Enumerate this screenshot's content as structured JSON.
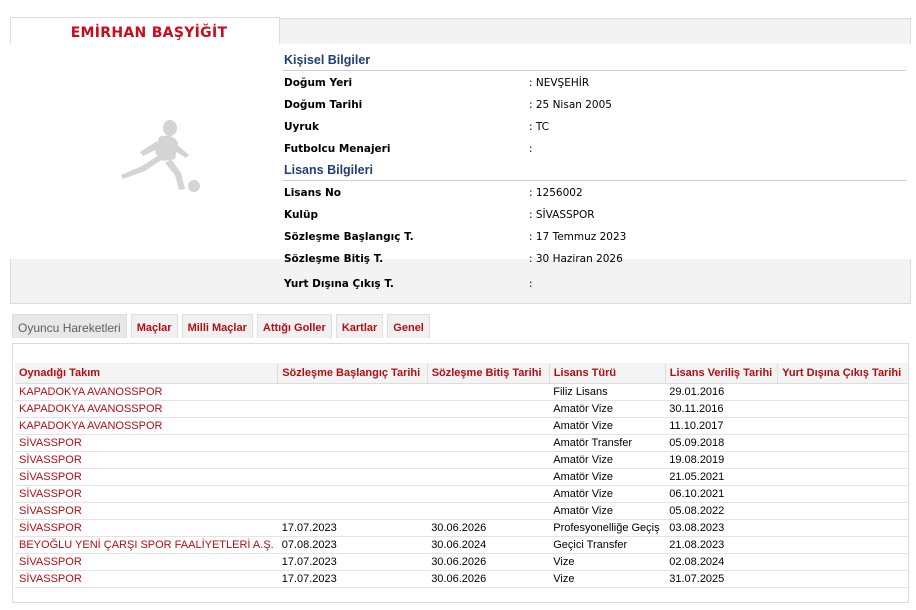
{
  "player": {
    "name": "EMİRHAN BAŞYİĞİT",
    "photo_icon": "footballer-silhouette-icon"
  },
  "personal": {
    "title": "Kişisel Bilgiler",
    "fields": [
      {
        "label": "Doğum Yeri",
        "value": ":  NEVŞEHİR"
      },
      {
        "label": "Doğum Tarihi",
        "value": ":  25 Nisan 2005"
      },
      {
        "label": "Uyruk",
        "value": ":  TC"
      },
      {
        "label": "Futbolcu Menajeri",
        "value": ":"
      }
    ]
  },
  "license": {
    "title": "Lisans Bilgileri",
    "fields": [
      {
        "label": "Lisans No",
        "value": ": 1256002"
      },
      {
        "label": "Kulüp",
        "value": ": SİVASSPOR"
      },
      {
        "label": "Sözleşme Başlangıç T.",
        "value": ": 17 Temmuz 2023"
      },
      {
        "label": "Sözleşme Bitiş T.",
        "value": ": 30 Haziran 2026"
      }
    ],
    "abroad": {
      "label": "Yurt Dışına Çıkış T.",
      "value": ":"
    }
  },
  "tabs": [
    "Oyuncu Hareketleri",
    "Maçlar",
    "Milli Maçlar",
    "Attığı Goller",
    "Kartlar",
    "Genel"
  ],
  "active_tab": "Oyuncu Hareketleri",
  "table": {
    "headers": [
      "Oynadığı Takım",
      "Sözleşme Başlangıç Tarihi",
      "Sözleşme Bitiş Tarihi",
      "Lisans Türü",
      "Lisans Veriliş Tarihi",
      "Yurt Dışına Çıkış Tarihi"
    ],
    "rows": [
      [
        "KAPADOKYA AVANOSSPOR",
        "",
        "",
        "Filiz Lisans",
        "29.01.2016",
        ""
      ],
      [
        "KAPADOKYA AVANOSSPOR",
        "",
        "",
        "Amatör Vize",
        "30.11.2016",
        ""
      ],
      [
        "KAPADOKYA AVANOSSPOR",
        "",
        "",
        "Amatör Vize",
        "11.10.2017",
        ""
      ],
      [
        "SİVASSPOR",
        "",
        "",
        "Amatör Transfer",
        "05.09.2018",
        ""
      ],
      [
        "SİVASSPOR",
        "",
        "",
        "Amatör Vize",
        "19.08.2019",
        ""
      ],
      [
        "SİVASSPOR",
        "",
        "",
        "Amatör Vize",
        "21.05.2021",
        ""
      ],
      [
        "SİVASSPOR",
        "",
        "",
        "Amatör Vize",
        "06.10.2021",
        ""
      ],
      [
        "SİVASSPOR",
        "",
        "",
        "Amatör Vize",
        "05.08.2022",
        ""
      ],
      [
        "SİVASSPOR",
        "17.07.2023",
        "30.06.2026",
        "Profesyonelliğe Geçiş",
        "03.08.2023",
        ""
      ],
      [
        "BEYOĞLU YENİ ÇARŞI SPOR FAALİYETLERİ A.Ş.",
        "07.08.2023",
        "30.06.2024",
        "Geçici Transfer",
        "21.08.2023",
        ""
      ],
      [
        "SİVASSPOR",
        "17.07.2023",
        "30.06.2026",
        "Vize",
        "02.08.2024",
        ""
      ],
      [
        "SİVASSPOR",
        "17.07.2023",
        "30.06.2026",
        "Vize",
        "31.07.2025",
        ""
      ]
    ]
  },
  "colors": {
    "accent_red": "#cc0a1e",
    "section_blue": "#1f3f72",
    "panel_bg": "#f3f3f3"
  }
}
